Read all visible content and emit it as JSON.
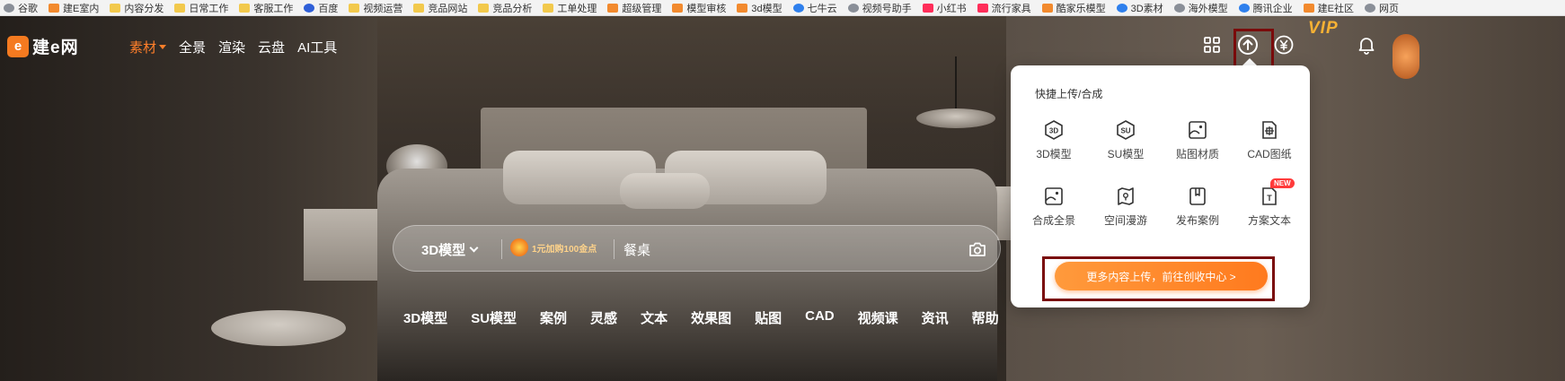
{
  "bookmarks": [
    {
      "label": "谷歌",
      "icon": "globe-icon"
    },
    {
      "label": "建E室内",
      "icon": "jiane-icon"
    },
    {
      "label": "内容分发",
      "icon": "folder-icon"
    },
    {
      "label": "日常工作",
      "icon": "folder-icon"
    },
    {
      "label": "客服工作",
      "icon": "folder-icon"
    },
    {
      "label": "百度",
      "icon": "baidu-icon"
    },
    {
      "label": "视频运营",
      "icon": "folder-icon"
    },
    {
      "label": "竞品网站",
      "icon": "folder-icon"
    },
    {
      "label": "竞品分析",
      "icon": "folder-icon"
    },
    {
      "label": "工单处理",
      "icon": "folder-icon"
    },
    {
      "label": "超级管理",
      "icon": "jiane-icon"
    },
    {
      "label": "模型审核",
      "icon": "jiane-icon"
    },
    {
      "label": "3d模型",
      "icon": "jiane-icon"
    },
    {
      "label": "七牛云",
      "icon": "cloud-icon"
    },
    {
      "label": "视频号助手",
      "icon": "globe-icon"
    },
    {
      "label": "小红书",
      "icon": "xhs-icon"
    },
    {
      "label": "流行家具",
      "icon": "xhs-icon"
    },
    {
      "label": "酷家乐模型",
      "icon": "jiane-icon"
    },
    {
      "label": "3D素材",
      "icon": "cloud-icon"
    },
    {
      "label": "海外模型",
      "icon": "globe-icon"
    },
    {
      "label": "腾讯企业",
      "icon": "cloud-icon"
    },
    {
      "label": "建E社区",
      "icon": "jiane-icon"
    },
    {
      "label": "网页",
      "icon": "globe-icon"
    }
  ],
  "nav": {
    "logo_mark": "e",
    "logo_text": "建e网",
    "links": [
      "素材",
      "全景",
      "渲染",
      "云盘",
      "AI工具"
    ],
    "vip": "VIP"
  },
  "search": {
    "type_label": "3D模型",
    "promo": "1元加购100金点",
    "value": "餐桌"
  },
  "categories": [
    "3D模型",
    "SU模型",
    "案例",
    "灵感",
    "文本",
    "效果图",
    "贴图",
    "CAD",
    "视频课",
    "资讯",
    "帮助"
  ],
  "upload_panel": {
    "title": "快捷上传/合成",
    "items": [
      {
        "label": "3D模型",
        "icon": "3d-model-icon"
      },
      {
        "label": "SU模型",
        "icon": "su-model-icon"
      },
      {
        "label": "贴图材质",
        "icon": "texture-icon"
      },
      {
        "label": "CAD图纸",
        "icon": "cad-icon"
      },
      {
        "label": "合成全景",
        "icon": "panorama-icon"
      },
      {
        "label": "空间漫游",
        "icon": "space-tour-icon"
      },
      {
        "label": "发布案例",
        "icon": "case-icon"
      },
      {
        "label": "方案文本",
        "icon": "text-doc-icon"
      }
    ],
    "new_badge": "NEW",
    "cta": "更多内容上传，前往创收中心 >"
  },
  "colors": {
    "accent": "#ff7f2a",
    "vip": "#f8b234",
    "highlight": "#7a0b0b"
  }
}
